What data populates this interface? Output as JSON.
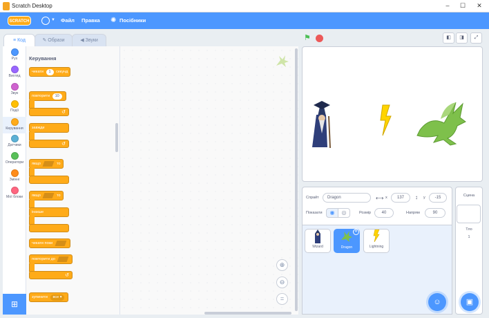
{
  "window": {
    "title": "Scratch Desktop",
    "minimize_icon": "minimize-icon",
    "maximize_icon": "maximize-icon",
    "close_icon": "close-icon"
  },
  "menubar": {
    "logo": "SCRATCH",
    "file": "Файл",
    "edit": "Правка",
    "tutorials": "Посібники",
    "colors": {
      "bar": "#4c97ff"
    }
  },
  "tabs": [
    {
      "label": "Код",
      "icon": "code-icon",
      "active": true
    },
    {
      "label": "Образи",
      "icon": "brush-icon",
      "active": false
    },
    {
      "label": "Звуки",
      "icon": "speaker-icon",
      "active": false
    }
  ],
  "categories": [
    {
      "label": "Рух",
      "color": "#4c97ff"
    },
    {
      "label": "Вигляд",
      "color": "#9966ff"
    },
    {
      "label": "Звук",
      "color": "#cf63cf"
    },
    {
      "label": "Події",
      "color": "#ffbf00"
    },
    {
      "label": "Керування",
      "color": "#ffab19"
    },
    {
      "label": "Датчики",
      "color": "#5cb1d6"
    },
    {
      "label": "Оператори",
      "color": "#59c059"
    },
    {
      "label": "Змінні",
      "color": "#ff8c1a"
    },
    {
      "label": "Мої блоки",
      "color": "#ff6680"
    }
  ],
  "palette": {
    "title": "Керування",
    "wait_prefix": "чекати",
    "wait_value": "1",
    "wait_suffix": "секунд",
    "repeat_label": "повторити",
    "repeat_value": "10",
    "forever_label": "завжди",
    "if_label": "якщо",
    "then_label": "то",
    "else_label": "інакше",
    "wait_until_label": "чекати поки",
    "repeat_until_label": "повторити до",
    "stop_label": "зупинити",
    "stop_value": "все"
  },
  "sprite_info": {
    "sprite_label": "Спрайт",
    "sprite_name": "Dragon",
    "x_label": "x",
    "x_value": "137",
    "y_label": "y",
    "y_value": "-15",
    "show_label": "Показати",
    "size_label": "Розмір",
    "size_value": "40",
    "direction_label": "Напрям",
    "direction_value": "90"
  },
  "sprites": [
    {
      "name": "Wizard",
      "icon": "wizard-icon",
      "selected": false
    },
    {
      "name": "Dragon",
      "icon": "dragon-icon",
      "selected": true
    },
    {
      "name": "Lightning",
      "icon": "lightning-icon",
      "selected": false
    }
  ],
  "stage_pane": {
    "title": "Сцена",
    "backdrops_label": "Тло",
    "backdrops_count": "1"
  }
}
